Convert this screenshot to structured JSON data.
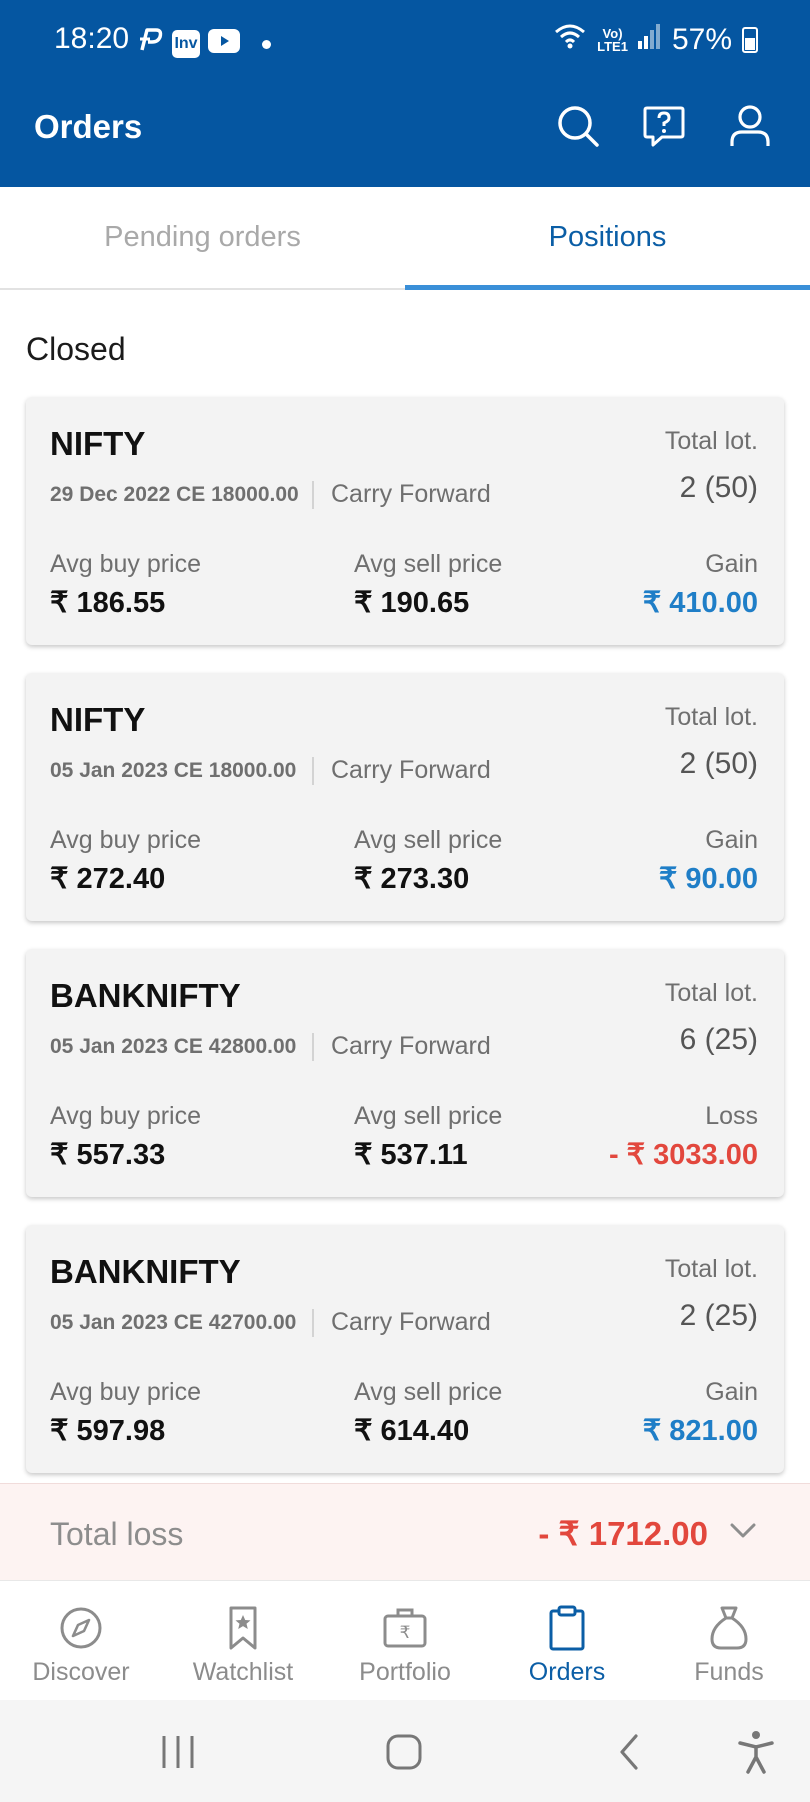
{
  "status_bar": {
    "time": "18:20",
    "apps": [
      "paytm-icon",
      "inv-icon",
      "youtube-icon"
    ],
    "inv_label": "Inv",
    "volte": "Vo)",
    "lte": "LTE1",
    "battery": "57%"
  },
  "header": {
    "title": "Orders",
    "icons": [
      "search-icon",
      "help-icon",
      "profile-icon"
    ]
  },
  "tabs": [
    {
      "label": "Pending orders",
      "active": false
    },
    {
      "label": "Positions",
      "active": true
    }
  ],
  "section_title": "Closed",
  "positions": [
    {
      "symbol": "NIFTY",
      "contract": "29 Dec 2022 CE 18000.00",
      "product": "Carry Forward",
      "lot_label": "Total lot.",
      "lot_value": "2 (50)",
      "buy_label": "Avg buy price",
      "buy_value": "₹ 186.55",
      "sell_label": "Avg sell price",
      "sell_value": "₹ 190.65",
      "pl_label": "Gain",
      "pl_value": "₹ 410.00"
    },
    {
      "symbol": "NIFTY",
      "contract": "05 Jan 2023 CE 18000.00",
      "product": "Carry Forward",
      "lot_label": "Total lot.",
      "lot_value": "2 (50)",
      "buy_label": "Avg buy price",
      "buy_value": "₹ 272.40",
      "sell_label": "Avg sell price",
      "sell_value": "₹ 273.30",
      "pl_label": "Gain",
      "pl_value": "₹ 90.00"
    },
    {
      "symbol": "BANKNIFTY",
      "contract": "05 Jan 2023 CE 42800.00",
      "product": "Carry Forward",
      "lot_label": "Total lot.",
      "lot_value": "6 (25)",
      "buy_label": "Avg buy price",
      "buy_value": "₹ 557.33",
      "sell_label": "Avg sell price",
      "sell_value": "₹ 537.11",
      "pl_label": "Loss",
      "pl_value": "- ₹ 3033.00"
    },
    {
      "symbol": "BANKNIFTY",
      "contract": "05 Jan 2023 CE 42700.00",
      "product": "Carry Forward",
      "lot_label": "Total lot.",
      "lot_value": "2 (25)",
      "buy_label": "Avg buy price",
      "buy_value": "₹ 597.98",
      "sell_label": "Avg sell price",
      "sell_value": "₹ 614.40",
      "pl_label": "Gain",
      "pl_value": "₹ 821.00"
    }
  ],
  "total": {
    "label": "Total loss",
    "value": "- ₹ 1712.00",
    "icon": "chevron-down-icon"
  },
  "bottom_nav": [
    {
      "label": "Discover",
      "icon": "compass-icon",
      "active": false
    },
    {
      "label": "Watchlist",
      "icon": "bookmark-star-icon",
      "active": false
    },
    {
      "label": "Portfolio",
      "icon": "briefcase-rupee-icon",
      "active": false
    },
    {
      "label": "Orders",
      "icon": "clipboard-icon",
      "active": true
    },
    {
      "label": "Funds",
      "icon": "money-bag-icon",
      "active": false
    }
  ],
  "colors": {
    "header_bg": "#0556a1",
    "accent": "#0b5ea6",
    "gain": "#1f7ec7",
    "loss": "#e2473d"
  }
}
